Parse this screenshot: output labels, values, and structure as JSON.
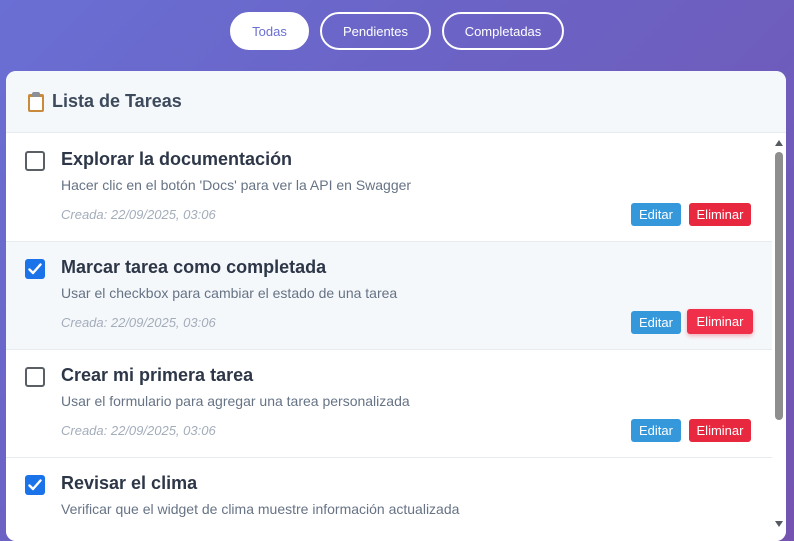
{
  "filters": [
    {
      "label": "Todas",
      "active": true
    },
    {
      "label": "Pendientes",
      "active": false
    },
    {
      "label": "Completadas",
      "active": false
    }
  ],
  "header": {
    "icon": "clipboard-icon",
    "title": "Lista de Tareas"
  },
  "tasks": [
    {
      "title": "Explorar la documentación",
      "description": "Hacer clic en el botón 'Docs' para ver la API en Swagger",
      "created": "Creada: 22/09/2025, 03:06",
      "completed": false,
      "edit_label": "Editar",
      "delete_label": "Eliminar"
    },
    {
      "title": "Marcar tarea como completada",
      "description": "Usar el checkbox para cambiar el estado de una tarea",
      "created": "Creada: 22/09/2025, 03:06",
      "completed": true,
      "edit_label": "Editar",
      "delete_label": "Eliminar"
    },
    {
      "title": "Crear mi primera tarea",
      "description": "Usar el formulario para agregar una tarea personalizada",
      "created": "Creada: 22/09/2025, 03:06",
      "completed": false,
      "edit_label": "Editar",
      "delete_label": "Eliminar"
    },
    {
      "title": "Revisar el clima",
      "description": "Verificar que el widget de clima muestre información actualizada",
      "created": "",
      "completed": true,
      "edit_label": "",
      "delete_label": ""
    }
  ],
  "colors": {
    "accent": "#6a6fd4",
    "edit": "#3498db",
    "delete": "#e8283f",
    "checkbox_checked": "#1a73e8"
  }
}
